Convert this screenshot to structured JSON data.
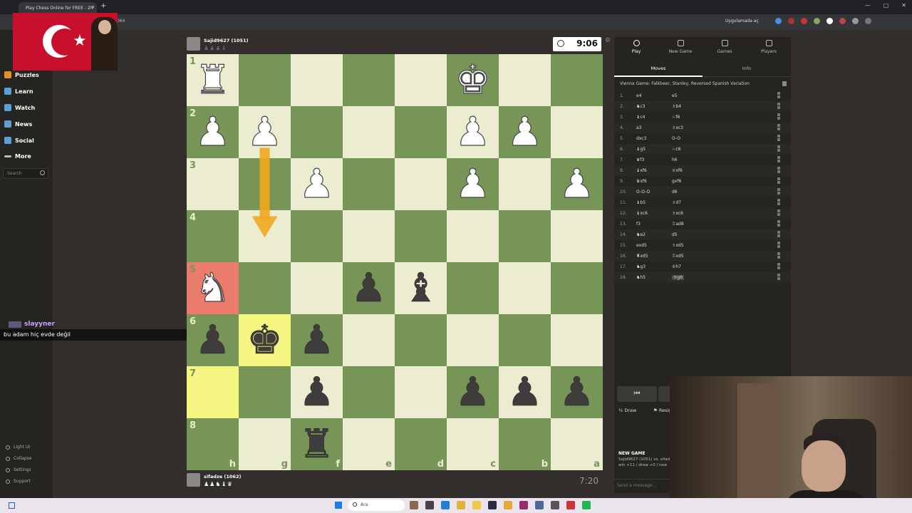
{
  "browser": {
    "tab_title": "Play Chess Online for FREE - 2 P",
    "url_fragment": "3064",
    "open_in_app": "Uygulamada aç"
  },
  "sidebar": {
    "items": [
      {
        "label": "Puzzles",
        "icon": "puzzle-icon",
        "color": "#e58f2a"
      },
      {
        "label": "Learn",
        "icon": "learn-icon",
        "color": "#5b9fd6"
      },
      {
        "label": "Watch",
        "icon": "watch-icon",
        "color": "#5b9fd6"
      },
      {
        "label": "News",
        "icon": "news-icon",
        "color": "#5b9fd6"
      },
      {
        "label": "Social",
        "icon": "social-icon",
        "color": "#5b9fd6"
      },
      {
        "label": "More",
        "icon": "more-icon",
        "color": "#bbbbbb"
      }
    ],
    "search_placeholder": "Search",
    "bottom": [
      "Light UI",
      "Collapse",
      "Settings",
      "Support"
    ]
  },
  "chat": {
    "user": "slayyner",
    "message": "bu adam hiç evde değil"
  },
  "top_player": {
    "name": "Sajid9627 (1051)",
    "clock": "9:06"
  },
  "bottom_player": {
    "name": "sifadze (1062)",
    "captured": "♟♟♞♝♛",
    "clock": "7:20"
  },
  "board": {
    "orientation": "black",
    "ranks": [
      "1",
      "2",
      "3",
      "4",
      "5",
      "6",
      "7",
      "8"
    ],
    "files": [
      "h",
      "g",
      "f",
      "e",
      "d",
      "c",
      "b",
      "a"
    ],
    "highlight_squares": [
      "h5",
      "h7",
      "g6"
    ],
    "arrow": {
      "from": "g2",
      "to": "g4",
      "color": "#f0a81e"
    },
    "pieces": [
      {
        "sq": "h1",
        "glyph": "♜",
        "side": "w",
        "name": "white-rook"
      },
      {
        "sq": "c1",
        "glyph": "♚",
        "side": "w",
        "name": "white-king"
      },
      {
        "sq": "h2",
        "glyph": "♟",
        "side": "w",
        "name": "white-pawn"
      },
      {
        "sq": "g2",
        "glyph": "♟",
        "side": "w",
        "name": "white-pawn"
      },
      {
        "sq": "c2",
        "glyph": "♟",
        "side": "w",
        "name": "white-pawn"
      },
      {
        "sq": "b2",
        "glyph": "♟",
        "side": "w",
        "name": "white-pawn"
      },
      {
        "sq": "f3",
        "glyph": "♟",
        "side": "w",
        "name": "white-pawn"
      },
      {
        "sq": "c3",
        "glyph": "♟",
        "side": "w",
        "name": "white-pawn"
      },
      {
        "sq": "a3",
        "glyph": "♟",
        "side": "w",
        "name": "white-pawn"
      },
      {
        "sq": "h5",
        "glyph": "♞",
        "side": "w",
        "name": "white-knight"
      },
      {
        "sq": "e5",
        "glyph": "♟",
        "side": "b",
        "name": "black-pawn"
      },
      {
        "sq": "d5",
        "glyph": "♝",
        "side": "b",
        "name": "black-bishop"
      },
      {
        "sq": "h6",
        "glyph": "♟",
        "side": "b",
        "name": "black-pawn"
      },
      {
        "sq": "g6",
        "glyph": "♚",
        "side": "b",
        "name": "black-king"
      },
      {
        "sq": "f6",
        "glyph": "♟",
        "side": "b",
        "name": "black-pawn"
      },
      {
        "sq": "f7",
        "glyph": "♟",
        "side": "b",
        "name": "black-pawn"
      },
      {
        "sq": "c7",
        "glyph": "♟",
        "side": "b",
        "name": "black-pawn"
      },
      {
        "sq": "b7",
        "glyph": "♟",
        "side": "b",
        "name": "black-pawn"
      },
      {
        "sq": "a7",
        "glyph": "♟",
        "side": "b",
        "name": "black-pawn"
      },
      {
        "sq": "f8",
        "glyph": "♜",
        "side": "b",
        "name": "black-rook"
      }
    ]
  },
  "panel": {
    "tabs": [
      "Play",
      "New Game",
      "Games",
      "Players"
    ],
    "subtabs": [
      "Moves",
      "Info"
    ],
    "opening": "Vienna Game: Falkbeer, Stanley, Reversed Spanish Variation",
    "moves": [
      {
        "n": "1.",
        "w": "e4",
        "b": "e5"
      },
      {
        "n": "2.",
        "w": "♞c3",
        "b": "♗b4"
      },
      {
        "n": "3.",
        "w": "♝c4",
        "b": "♘f6"
      },
      {
        "n": "4.",
        "w": "a3",
        "b": "♗xc3"
      },
      {
        "n": "5.",
        "w": "dxc3",
        "b": "O-O"
      },
      {
        "n": "6.",
        "w": "♝g5",
        "b": "♘c6"
      },
      {
        "n": "7.",
        "w": "♛f3",
        "b": "h6"
      },
      {
        "n": "8.",
        "w": "♝xf6",
        "b": "♕xf6"
      },
      {
        "n": "9.",
        "w": "♛xf6",
        "b": "gxf6"
      },
      {
        "n": "10.",
        "w": "O-O-O",
        "b": "d6"
      },
      {
        "n": "11.",
        "w": "♝b5",
        "b": "♗d7"
      },
      {
        "n": "12.",
        "w": "♝xc6",
        "b": "♗xc6"
      },
      {
        "n": "13.",
        "w": "f3",
        "b": "♖ad8"
      },
      {
        "n": "14.",
        "w": "♞e2",
        "b": "d5"
      },
      {
        "n": "15.",
        "w": "exd5",
        "b": "♗xd5"
      },
      {
        "n": "16.",
        "w": "♜xd5",
        "b": "♖xd5"
      },
      {
        "n": "17.",
        "w": "♞g3",
        "b": "♔h7"
      },
      {
        "n": "18.",
        "w": "♞h5",
        "b": "♔g6"
      }
    ],
    "draw": "Draw",
    "resign": "Resign",
    "newgame_title": "NEW GAME",
    "newgame_line1": "Sajid9627 (1051) vs. sifadz",
    "newgame_line2": "win +11 / draw +0 / lose",
    "send_placeholder": "Send a message..."
  },
  "taskbar": {
    "search": "Ara"
  }
}
